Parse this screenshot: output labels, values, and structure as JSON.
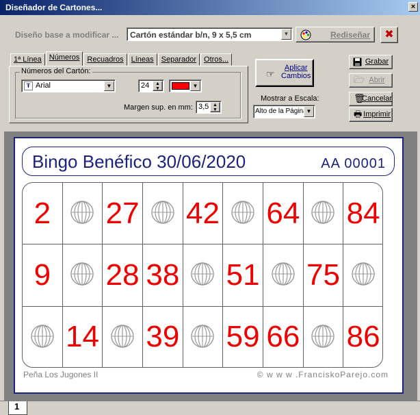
{
  "window": {
    "title": "Diseñador de Cartones...",
    "close_symbol": "×"
  },
  "toolbar": {
    "base_label": "Diseño base a modificar ...",
    "base_value": "Cartón estándar b/n, 9 x 5,5 cm",
    "redesign_label": "Rediseñar",
    "cancel_symbol": "✖"
  },
  "tabs": [
    {
      "label": "1ª Línea"
    },
    {
      "label": "Números",
      "active": true
    },
    {
      "label": "Recuadros"
    },
    {
      "label": "Líneas"
    },
    {
      "label": "Separador"
    },
    {
      "label": "Otros..."
    }
  ],
  "numbers_panel": {
    "group_label": "Números del Cartón:",
    "font_value": "Arial",
    "size_value": "24",
    "margin_label": "Margen sup. en mm:",
    "margin_value": "3,5"
  },
  "apply": {
    "line1": "Aplicar",
    "line2": "Cambios"
  },
  "scale": {
    "label": "Mostrar a Escala:",
    "value": "Alto de la Página"
  },
  "side_buttons": {
    "save": "Grabar",
    "open": "Abrir",
    "cancel": "Cancelar",
    "print": "Imprimir"
  },
  "card": {
    "title": "Bingo Benéfico 30/06/2020",
    "serial": "AA 00001",
    "grid": [
      [
        "2",
        "",
        "27",
        "",
        "42",
        "",
        "64",
        "",
        "84"
      ],
      [
        "9",
        "",
        "28",
        "38",
        "",
        "51",
        "",
        "75",
        ""
      ],
      [
        "",
        "14",
        "",
        "39",
        "",
        "59",
        "66",
        "",
        "86"
      ]
    ],
    "footer_left": "Peña Los Jugones II",
    "footer_right": "© w w w .FranciskoParejo.com"
  },
  "sheet": {
    "tab": "1"
  },
  "colors": {
    "title_bar": "#0a246a",
    "number_red": "#e00000",
    "card_blue": "#1a237e",
    "color_swatch": "#ff0000"
  },
  "icons": [
    "save-icon",
    "open-icon",
    "trash-icon",
    "printer-icon",
    "hand-point-icon",
    "palette-icon",
    "font-icon",
    "spin-arrows-icon",
    "bingo-ball-icon"
  ]
}
